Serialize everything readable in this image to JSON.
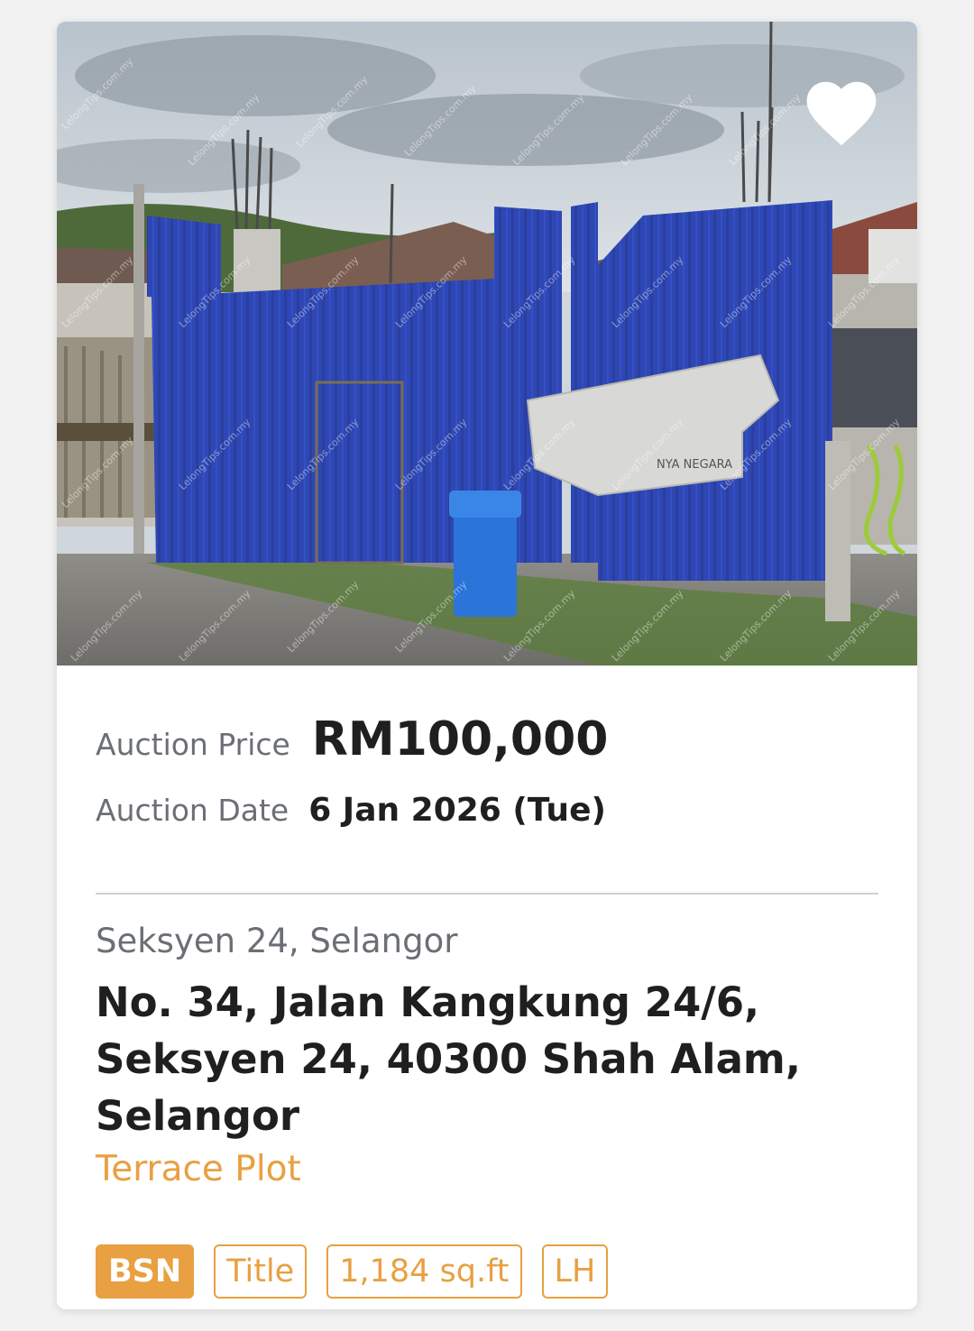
{
  "listing": {
    "favorite_icon": "heart-icon",
    "price_label": "Auction Price",
    "price_value": "RM100,000",
    "date_label": "Auction Date",
    "date_value": "6 Jan 2026 (Tue)",
    "area": "Seksyen 24, Selangor",
    "address": "No. 34, Jalan Kangkung 24/6, Seksyen 24, 40300 Shah Alam, Selangor",
    "property_type": "Terrace Plot",
    "tags": [
      "BSN",
      "Title",
      "1,184 sq.ft",
      "LH"
    ],
    "watermark": "LelongTips.com.my",
    "banner_text": "NYA NEGARA",
    "accent_color": "#e8a042"
  }
}
